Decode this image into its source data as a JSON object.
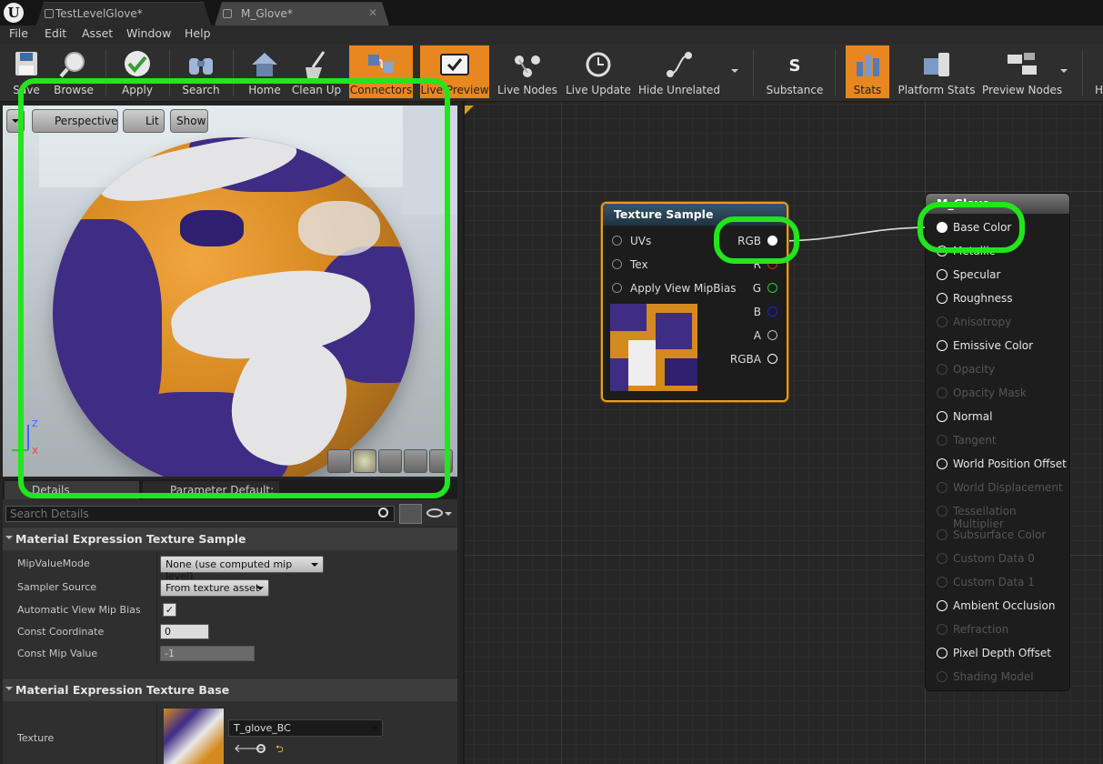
{
  "tabs": [
    {
      "label": "TestLevelGlove*"
    },
    {
      "label": "M_Glove*"
    }
  ],
  "menu": [
    "File",
    "Edit",
    "Asset",
    "Window",
    "Help"
  ],
  "toolbar": [
    {
      "label": "Save",
      "icon": "save-icon"
    },
    {
      "label": "Browse",
      "icon": "browse-icon"
    },
    {
      "label": "Apply",
      "icon": "apply-checkmark-icon"
    },
    {
      "label": "Search",
      "icon": "search-binoculars-icon"
    },
    {
      "label": "Home",
      "icon": "home-icon"
    },
    {
      "label": "Clean Up",
      "icon": "clean-up-icon"
    },
    {
      "label": "Connectors",
      "icon": "connectors-icon",
      "active": true
    },
    {
      "label": "Live Preview",
      "icon": "live-preview-icon",
      "active": true
    },
    {
      "label": "Live Nodes",
      "icon": "live-nodes-icon"
    },
    {
      "label": "Live Update",
      "icon": "live-update-icon"
    },
    {
      "label": "Hide Unrelated",
      "icon": "hide-unrelated-icon"
    },
    {
      "label": "Substance",
      "icon": "substance-icon"
    },
    {
      "label": "Stats",
      "icon": "stats-icon",
      "active": true
    },
    {
      "label": "Platform Stats",
      "icon": "platform-stats-icon"
    },
    {
      "label": "Preview Nodes",
      "icon": "preview-nodes-icon"
    },
    {
      "label": "H",
      "icon": "more-icon"
    }
  ],
  "viewport": {
    "buttons": [
      "Perspective",
      "Lit",
      "Show"
    ],
    "axis_z": "Z",
    "axis_x": "X"
  },
  "details": {
    "tabs": [
      "Details",
      "Parameter Default:"
    ],
    "search_placeholder": "Search Details",
    "section1": "Material Expression Texture Sample",
    "rows1": [
      {
        "label": "MipValueMode",
        "value": "None (use computed mip level)"
      },
      {
        "label": "Sampler Source",
        "value": "From texture asset"
      },
      {
        "label": "Automatic View Mip Bias",
        "value": "✓"
      },
      {
        "label": "Const Coordinate",
        "value": "0"
      },
      {
        "label": "Const Mip Value",
        "value": "-1"
      }
    ],
    "section2": "Material Expression Texture Base",
    "texture_label": "Texture",
    "texture_value": "T_glove_BC"
  },
  "texture_node": {
    "title": "Texture Sample",
    "inputs": [
      "UVs",
      "Tex",
      "Apply View MipBias"
    ],
    "outputs": [
      {
        "label": "RGB",
        "color": "#ffffff"
      },
      {
        "label": "R",
        "color": "#e02020"
      },
      {
        "label": "G",
        "color": "#20d020"
      },
      {
        "label": "B",
        "color": "#2020e0"
      },
      {
        "label": "A",
        "color": "#bbbbbb"
      },
      {
        "label": "RGBA",
        "color": "#ffffff"
      }
    ]
  },
  "material_node": {
    "title": "M_Glove",
    "pins": [
      {
        "label": "Base Color",
        "enabled": true
      },
      {
        "label": "Metallic",
        "enabled": true
      },
      {
        "label": "Specular",
        "enabled": true
      },
      {
        "label": "Roughness",
        "enabled": true
      },
      {
        "label": "Anisotropy",
        "enabled": false
      },
      {
        "label": "Emissive Color",
        "enabled": true
      },
      {
        "label": "Opacity",
        "enabled": false
      },
      {
        "label": "Opacity Mask",
        "enabled": false
      },
      {
        "label": "Normal",
        "enabled": true
      },
      {
        "label": "Tangent",
        "enabled": false
      },
      {
        "label": "World Position Offset",
        "enabled": true
      },
      {
        "label": "World Displacement",
        "enabled": false
      },
      {
        "label": "Tessellation Multiplier",
        "enabled": false
      },
      {
        "label": "Subsurface Color",
        "enabled": false
      },
      {
        "label": "Custom Data 0",
        "enabled": false
      },
      {
        "label": "Custom Data 1",
        "enabled": false
      },
      {
        "label": "Ambient Occlusion",
        "enabled": true
      },
      {
        "label": "Refraction",
        "enabled": false
      },
      {
        "label": "Pixel Depth Offset",
        "enabled": true
      },
      {
        "label": "Shading Model",
        "enabled": false
      }
    ]
  },
  "colors": {
    "accent": "#e8861f",
    "highlight": "#22e51e"
  }
}
